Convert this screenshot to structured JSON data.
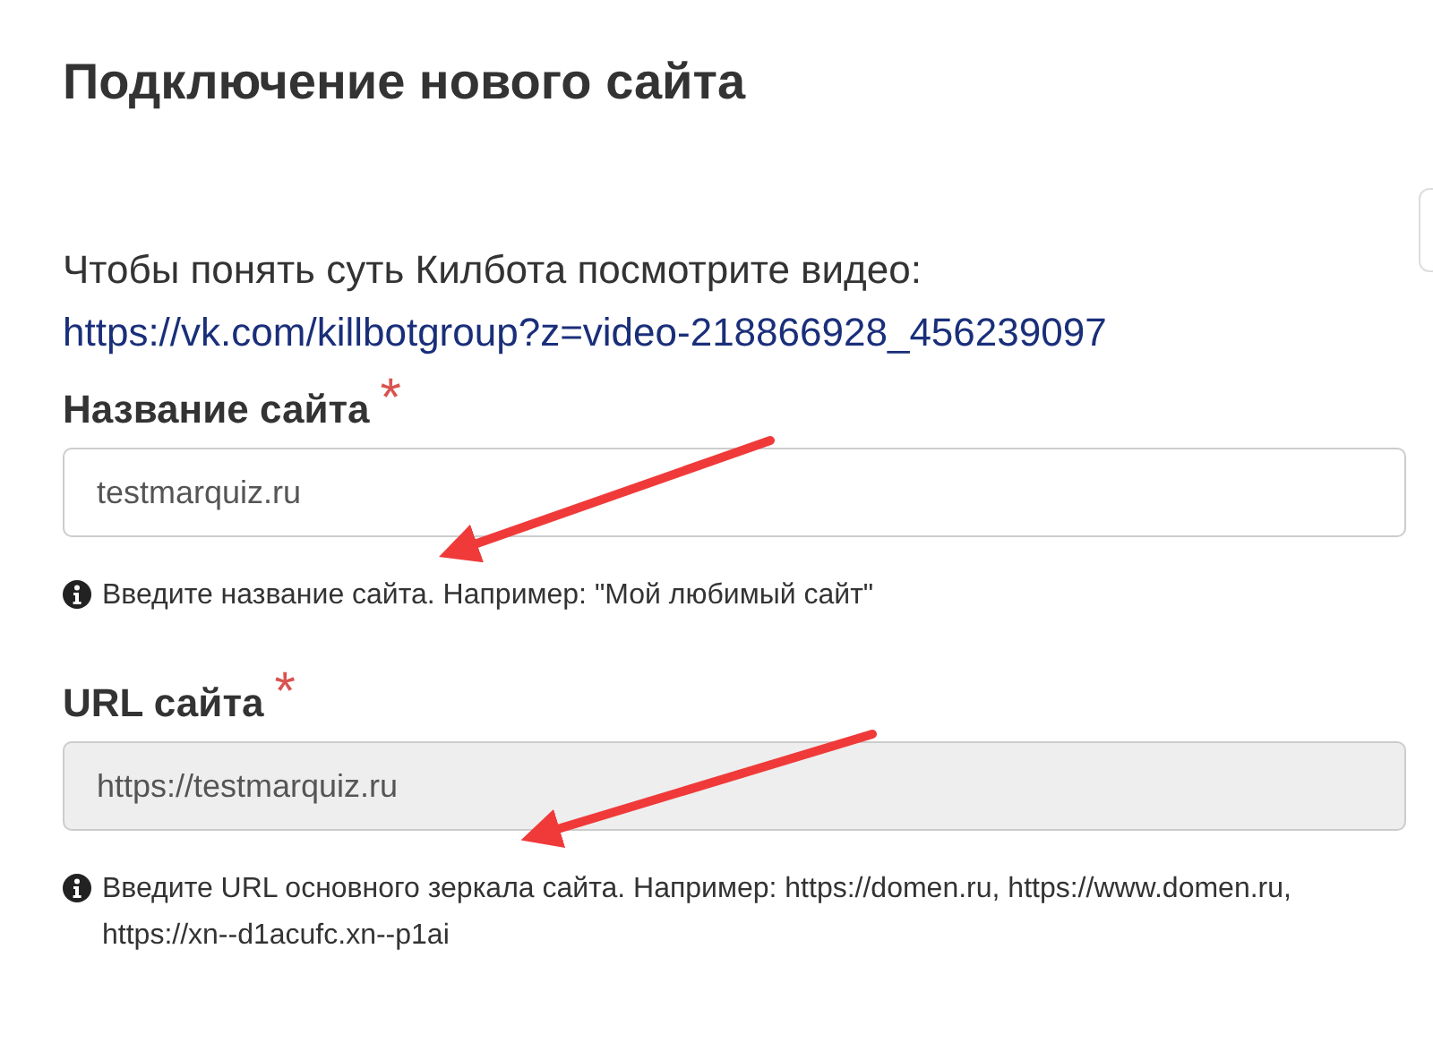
{
  "title": "Подключение нового сайта",
  "intro": {
    "text": "Чтобы понять суть Килбота посмотрите видео:",
    "link": "https://vk.com/killbotgroup?z=video-218866928_456239097"
  },
  "fields": [
    {
      "label": "Название сайта",
      "required_mark": "*",
      "value": "testmarquiz.ru",
      "disabled": false,
      "help": "Введите название сайта. Например: \"Мой любимый сайт\""
    },
    {
      "label": "URL сайта",
      "required_mark": "*",
      "value": "https://testmarquiz.ru",
      "disabled": true,
      "help": "Введите URL основного зеркала сайта. Например: https://domen.ru, https://www.domen.ru, https://xn--d1acufc.xn--p1ai"
    }
  ]
}
